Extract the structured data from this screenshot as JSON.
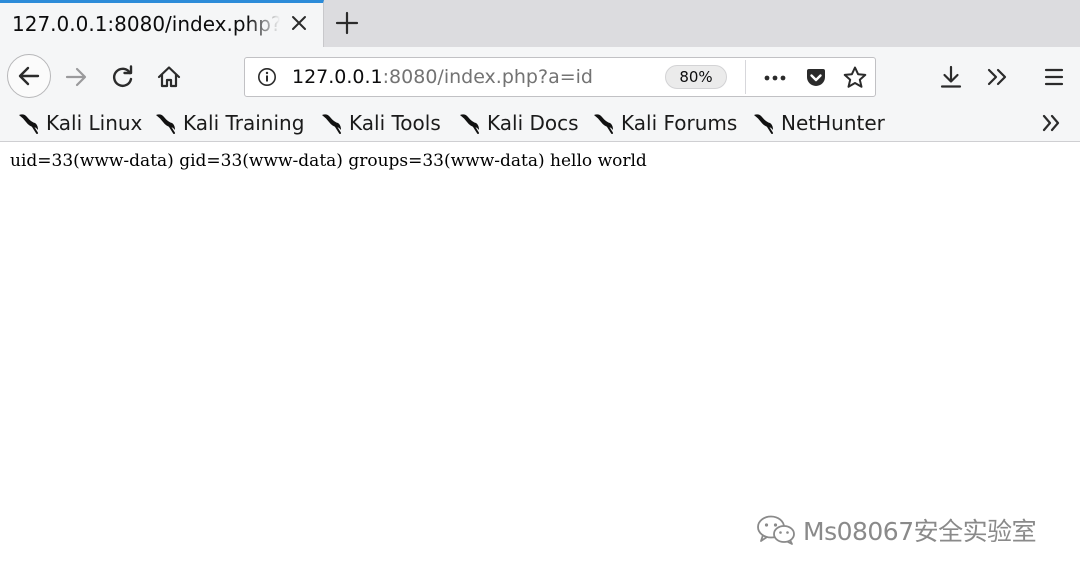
{
  "browser": {
    "tab": {
      "title": "127.0.0.1:8080/index.php?a=id"
    },
    "urlbar": {
      "host": "127.0.0.1",
      "rest": ":8080/index.php?a=id",
      "zoom": "80%"
    },
    "icons": {
      "back": "back-arrow-icon",
      "forward": "forward-arrow-icon",
      "reload": "reload-icon",
      "home": "home-icon",
      "info": "info-icon",
      "more": "more-dots-icon",
      "pocket": "pocket-icon",
      "bookmark": "star-icon",
      "download": "download-icon",
      "overflow": "chevron-double-right-icon",
      "menu": "hamburger-menu-icon"
    },
    "bookmarks": [
      {
        "label": "Kali Linux"
      },
      {
        "label": "Kali Training"
      },
      {
        "label": "Kali Tools"
      },
      {
        "label": "Kali Docs"
      },
      {
        "label": "Kali Forums"
      },
      {
        "label": "NetHunter"
      }
    ]
  },
  "page": {
    "output": "uid=33(www-data) gid=33(www-data) groups=33(www-data) hello world"
  },
  "watermark": {
    "text": "Ms08067安全实验室"
  },
  "colors": {
    "tab_accent": "#2c8cd9",
    "toolbar_bg": "#f5f6f7",
    "tabstrip_bg": "#dcdcdf",
    "icon": "#2b2b2b",
    "watermark": "#8a8a8a"
  }
}
